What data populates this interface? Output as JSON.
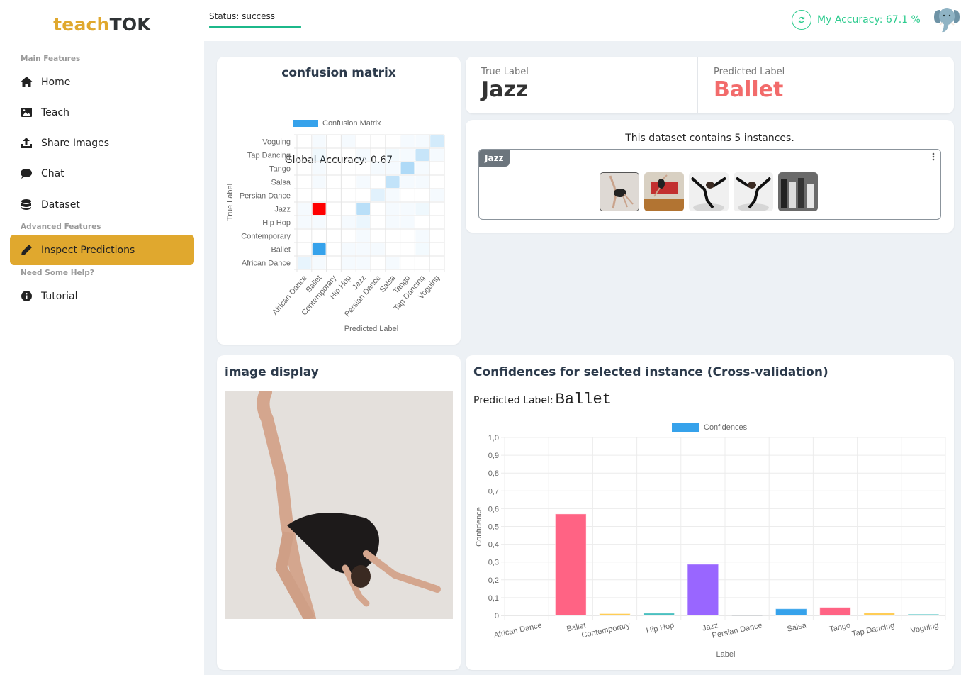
{
  "app": {
    "logo_part1": "teach",
    "logo_part2": "TOK",
    "status_text": "Status: success",
    "accuracy_text": "My Accuracy: 67.1 %",
    "accuracy_icon": "refresh-icon",
    "avatar": "elephant-avatar",
    "colors": {
      "brand": "#e0a82e",
      "success": "#1cb88a",
      "accuracy": "#2ecc8f",
      "predicted_wrong": "#f26b6b"
    }
  },
  "sidebar": {
    "sections": [
      {
        "title": "Main Features"
      },
      {
        "title": "Advanced Features"
      },
      {
        "title": "Need Some Help?"
      }
    ],
    "items": [
      {
        "label": "Home",
        "icon": "home-icon"
      },
      {
        "label": "Teach",
        "icon": "image-icon"
      },
      {
        "label": "Share Images",
        "icon": "upload-icon"
      },
      {
        "label": "Chat",
        "icon": "chat-icon"
      },
      {
        "label": "Dataset",
        "icon": "database-icon"
      },
      {
        "label": "Inspect Predictions",
        "icon": "pencil-icon",
        "active": true
      },
      {
        "label": "Tutorial",
        "icon": "info-icon"
      }
    ]
  },
  "confusion": {
    "title": "confusion matrix",
    "global_accuracy": "Global Accuracy: 0.67",
    "legend": "Confusion Matrix",
    "ylabel": "True Label",
    "xlabel": "Predicted Label"
  },
  "labels": {
    "true_caption": "True Label",
    "true_value": "Jazz",
    "pred_caption": "Predicted Label",
    "pred_value": "Ballet"
  },
  "dataset": {
    "summary": "This dataset contains 5 instances.",
    "class_badge": "Jazz",
    "menu_icon": "kebab-menu-icon",
    "thumbnails": [
      {
        "name": "dancer-backbend",
        "selected": true
      },
      {
        "name": "dancer-studio-leap",
        "selected": false
      },
      {
        "name": "dancer-split-leap",
        "selected": false
      },
      {
        "name": "dancer-split-leap-mirrored",
        "selected": false
      },
      {
        "name": "group-dancers-bw",
        "selected": false
      }
    ]
  },
  "image_display": {
    "title": "image display"
  },
  "confidences": {
    "title": "Confidences for selected instance (Cross-validation)",
    "pred_caption": "Predicted Label:",
    "pred_value": "Ballet"
  },
  "chart_data": [
    {
      "type": "heatmap",
      "title": "Confusion Matrix",
      "xlabel": "Predicted Label",
      "ylabel": "True Label",
      "x": [
        "African Dance",
        "Ballet",
        "Contemporary",
        "Hip Hop",
        "Jazz",
        "Persian Dance",
        "Salsa",
        "Tango",
        "Tap Dancing",
        "Voguing"
      ],
      "y": [
        "African Dance",
        "Ballet",
        "Contemporary",
        "Hip Hop",
        "Jazz",
        "Persian Dance",
        "Salsa",
        "Tango",
        "Tap Dancing",
        "Voguing"
      ],
      "legend": "Confusion Matrix",
      "highlight": {
        "true": "Jazz",
        "predicted": "Ballet",
        "color": "#ff0000"
      },
      "cells": [
        [
          0.12,
          0.02,
          0.0,
          0.04,
          0.02,
          0.0,
          0.03,
          0.0,
          0.0,
          0.0
        ],
        [
          0.0,
          1.0,
          0.0,
          0.03,
          0.05,
          0.04,
          0.0,
          0.0,
          0.06,
          0.0
        ],
        [
          0.0,
          0.0,
          0.0,
          0.0,
          0.04,
          0.0,
          0.0,
          0.0,
          0.03,
          0.0
        ],
        [
          0.02,
          0.02,
          0.0,
          0.05,
          0.1,
          0.0,
          0.02,
          0.02,
          0.0,
          0.0
        ],
        [
          0.02,
          1.0,
          0.0,
          0.0,
          0.35,
          0.0,
          0.04,
          0.03,
          0.08,
          0.0
        ],
        [
          0.0,
          0.0,
          0.0,
          0.0,
          0.0,
          0.15,
          0.02,
          0.0,
          0.0,
          0.05
        ],
        [
          0.0,
          0.04,
          0.0,
          0.0,
          0.03,
          0.0,
          0.3,
          0.05,
          0.02,
          0.0
        ],
        [
          0.0,
          0.02,
          0.0,
          0.0,
          0.0,
          0.03,
          0.05,
          0.4,
          0.02,
          0.0
        ],
        [
          0.0,
          0.08,
          0.0,
          0.0,
          0.04,
          0.0,
          0.06,
          0.03,
          0.28,
          0.02
        ],
        [
          0.0,
          0.03,
          0.0,
          0.04,
          0.0,
          0.0,
          0.0,
          0.03,
          0.04,
          0.22
        ]
      ]
    },
    {
      "type": "bar",
      "title": "",
      "legend": "Confidences",
      "xlabel": "Label",
      "ylabel": "Confidence",
      "ylim": [
        0,
        1.0
      ],
      "yticks": [
        "0",
        "0,1",
        "0,2",
        "0,3",
        "0,4",
        "0,5",
        "0,6",
        "0,7",
        "0,8",
        "0,9",
        "1,0"
      ],
      "categories": [
        "African Dance",
        "Ballet",
        "Contemporary",
        "Hip Hop",
        "Jazz",
        "Persian Dance",
        "Salsa",
        "Tango",
        "Tap Dancing",
        "Voguing"
      ],
      "values": [
        0.0,
        0.57,
        0.01,
        0.013,
        0.287,
        0.002,
        0.037,
        0.045,
        0.016,
        0.007
      ],
      "colors": [
        "#ff9f40",
        "#ff6384",
        "#ffcd56",
        "#4bc0c0",
        "#9966ff",
        "#c9cbcf",
        "#36a2eb",
        "#ff6384",
        "#ffcd56",
        "#4bc0c0"
      ]
    }
  ]
}
